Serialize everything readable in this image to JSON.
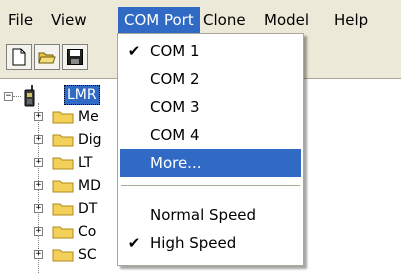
{
  "menubar": {
    "items": [
      "File",
      "View",
      "COM Port",
      "Clone",
      "Model",
      "Help"
    ]
  },
  "tree": {
    "root_label": "LMR",
    "children": [
      "Me",
      "Dig",
      "LT",
      "MD",
      "DT",
      "Co",
      "SC"
    ]
  },
  "com_menu": {
    "items": [
      {
        "label": "COM 1",
        "checked": true
      },
      {
        "label": "COM 2",
        "checked": false
      },
      {
        "label": "COM 3",
        "checked": false
      },
      {
        "label": "COM 4",
        "checked": false
      },
      {
        "label": "More...",
        "checked": false,
        "highlighted": true
      },
      {
        "label": "Normal Speed",
        "checked": false
      },
      {
        "label": "High Speed",
        "checked": true
      }
    ],
    "check_glyph": "✔"
  },
  "colors": {
    "highlight": "#316ac5",
    "menubar_bg": "#ece9d8"
  },
  "icons": {
    "toolbar": [
      "new-document-icon",
      "open-folder-icon",
      "save-disk-icon"
    ],
    "tree_root": "radio-device-icon",
    "tree_child": "folder-icon"
  }
}
